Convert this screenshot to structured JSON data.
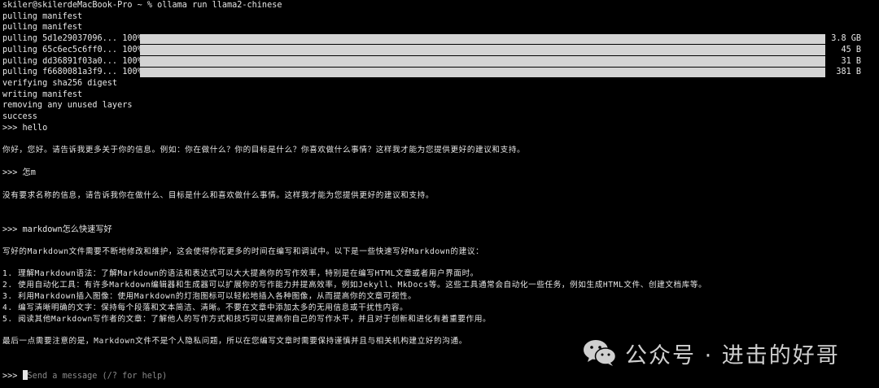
{
  "terminal": {
    "prompt_command": "skiler@skilerdeMacBook-Pro ~ % ollama run llama2-chinese",
    "pull_lines": [
      "pulling manifest",
      "pulling manifest"
    ],
    "layers": [
      {
        "label": "pulling 5d1e29037096... 100%",
        "progress": 1.0,
        "size": "3.8 GB"
      },
      {
        "label": "pulling 65c6ec5c6ff0... 100%",
        "progress": 1.0,
        "size": "45 B"
      },
      {
        "label": "pulling dd36891f03a0... 100%",
        "progress": 1.0,
        "size": "31 B"
      },
      {
        "label": "pulling f6680081a3f9... 100%",
        "progress": 1.0,
        "size": "381 B"
      }
    ],
    "status_lines": [
      "verifying sha256 digest",
      "writing manifest",
      "removing any unused layers",
      "success"
    ],
    "q1": ">>> hello",
    "a1": "你好，您好。请告诉我更多关于你的信息。例如：你在做什么？你的目标是什么？你喜欢做什么事情？这样我才能为您提供更好的建议和支持。",
    "q2": ">>> 怎m",
    "a2": "没有要求名称的信息，请告诉我你在做什么、目标是什么和喜欢做什么事情。这样我才能为您提供更好的建议和支持。",
    "q3": ">>> markdown怎么快速写好",
    "a3_intro": "写好的Markdown文件需要不断地修改和维护，这会使得你花更多的时间在编写和调试中。以下是一些快速写好Markdown的建议：",
    "a3_items": [
      "1. 理解Markdown语法：了解Markdown的语法和表达式可以大大提高你的写作效率，特别是在编写HTML文章或者用户界面时。",
      "2. 使用自动化工具：有许多Markdown编辑器和生成器可以扩展你的写作能力并提高效率，例如Jekyll、MkDocs等。这些工具通常会自动化一些任务，例如生成HTML文件、创建文档库等。",
      "3. 利用Markdown插入图像：使用Markdown的灯泡图标可以轻松地插入各种图像，从而提高你的文章可视性。",
      "4. 编写清晰明确的文字：保持每个段落和文本简洁、清晰。不要在文章中添加太多的无用信息或干扰性内容。",
      "5. 阅读其他Markdown写作者的文章：了解他人的写作方式和技巧可以提高你自己的写作水平，并且对于创新和进化有着重要作用。"
    ],
    "a3_final": "最后一点需要注意的是，Markdown文件不是个人隐私问题，所以在您编写文章时需要保持谨慎并且与相关机构建立好的沟通。",
    "input_prompt": ">>> ",
    "input_placeholder": "Send a message (/? for help)"
  },
  "watermark": {
    "text": "公众号 · 进击的好哥",
    "icon": "wechat-icon"
  },
  "colors": {
    "background": "#000000",
    "text": "#e6e6e6",
    "progress_bar": "#d4d4d4",
    "placeholder": "#8a8a8a"
  }
}
